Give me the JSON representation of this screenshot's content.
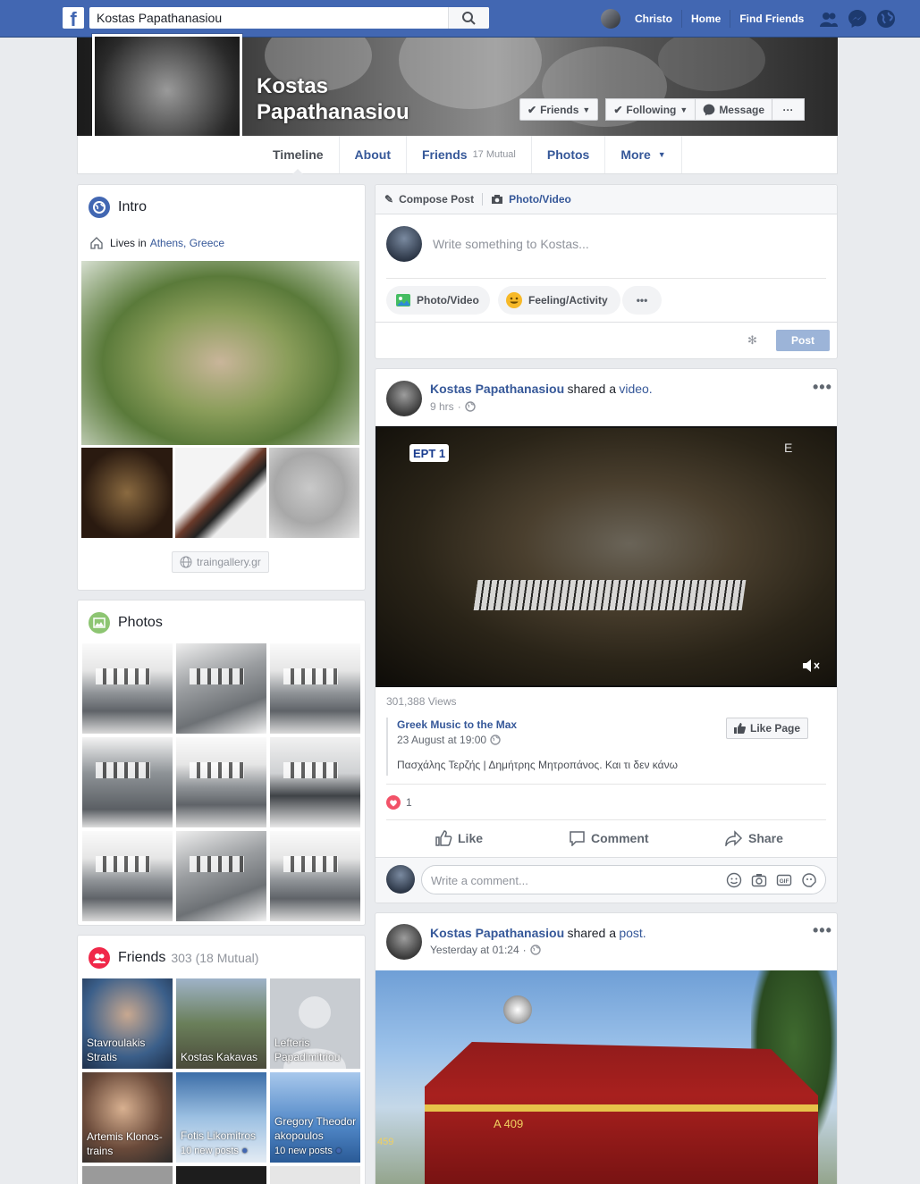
{
  "topbar": {
    "search_value": "Kostas Papathanasiou",
    "user_name": "Christo",
    "home": "Home",
    "find_friends": "Find Friends"
  },
  "profile": {
    "name": "Kostas Papathanasiou",
    "friends_btn": "Friends",
    "following_btn": "Following",
    "message_btn": "Message",
    "more_btn": "···"
  },
  "tabs": [
    {
      "label": "Timeline"
    },
    {
      "label": "About"
    },
    {
      "label": "Friends",
      "sub": "17 Mutual"
    },
    {
      "label": "Photos"
    },
    {
      "label": "More"
    }
  ],
  "intro": {
    "title": "Intro",
    "lives_in": "Lives in",
    "city": "Athens, Greece",
    "website": "traingallery.gr"
  },
  "photos_card": {
    "title": "Photos"
  },
  "friends_card": {
    "title": "Friends",
    "count": "303 (18 Mutual)",
    "friends": [
      {
        "name": "Stavroulakis Stratis"
      },
      {
        "name": "Kostas Kakavas"
      },
      {
        "name": "Lefteris Papadimitriou"
      },
      {
        "name": "Artemis Klonos-trains"
      },
      {
        "name": "Fotis Likomitros",
        "extra": "10 new posts"
      },
      {
        "name": "Gregory Theodorakopoulos",
        "extra": "10 new posts"
      }
    ]
  },
  "composer": {
    "compose_post": "Compose Post",
    "photo_video_tab": "Photo/Video",
    "placeholder": "Write something to Kostas...",
    "photo_video_btn": "Photo/Video",
    "feeling_btn": "Feeling/Activity",
    "more": "•••",
    "post_btn": "Post"
  },
  "post1": {
    "author": "Kostas Papathanasiou",
    "action": "shared a",
    "object": "video.",
    "time": "9 hrs",
    "video_channel": "EPT 1",
    "views": "301,388 Views",
    "page_name": "Greek Music to the Max",
    "page_date": "23 August at 19:00",
    "like_page": "Like Page",
    "description": "Πασχάλης Τερζής | Δημήτρης Μητροπάνος. Και τι δεν κάνω",
    "reactions": "1",
    "like": "Like",
    "comment": "Comment",
    "share": "Share",
    "comment_placeholder": "Write a comment..."
  },
  "post2": {
    "author": "Kostas Papathanasiou",
    "action": "shared a",
    "object": "post.",
    "time": "Yesterday at 01:24",
    "loco_number": "A 409",
    "loco_number2": "459"
  }
}
